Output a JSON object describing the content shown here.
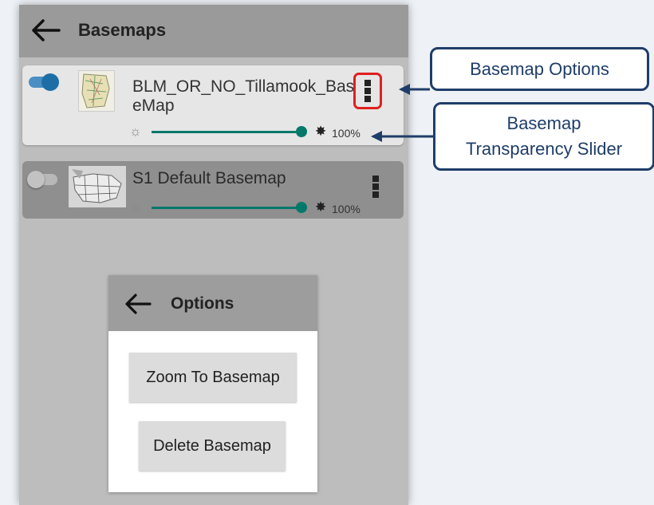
{
  "header": {
    "title": "Basemaps",
    "back_icon": "arrow-left-icon"
  },
  "basemaps": [
    {
      "name": "BLM_OR_NO_Tillamook_BaseMap",
      "enabled": true,
      "transparency_label": "100%",
      "transparency": 1.0
    },
    {
      "name": "S1 Default Basemap",
      "enabled": false,
      "transparency_label": "100%",
      "transparency": 1.0
    }
  ],
  "options_dialog": {
    "title": "Options",
    "zoom_label": "Zoom To Basemap",
    "delete_label": "Delete Basemap"
  },
  "callouts": {
    "options": "Basemap Options",
    "transparency_line1": "Basemap",
    "transparency_line2": "Transparency Slider"
  },
  "colors": {
    "accent": "#00796b",
    "toggle_on": "#1e6ea6",
    "highlight": "#e02020",
    "callout": "#1f3d69"
  }
}
